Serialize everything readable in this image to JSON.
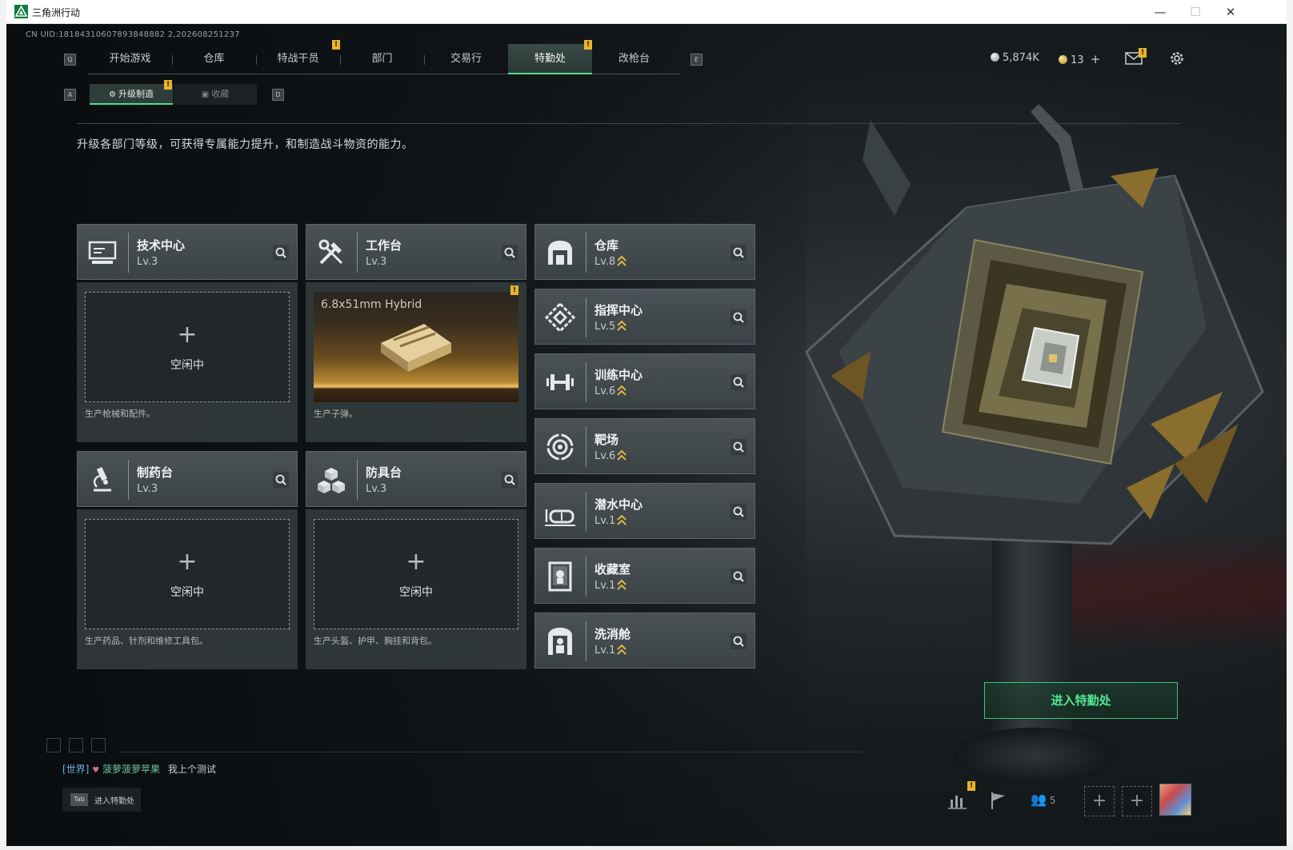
{
  "window": {
    "title": "三角洲行动",
    "buttons": {
      "minimize": "—",
      "maximize": "☐",
      "close": "✕"
    }
  },
  "uid": "CN UID:18184310607893848882 2,202608251237",
  "nav": {
    "left_key": "Q",
    "right_key": "E",
    "tabs": [
      "开始游戏",
      "仓库",
      "特战干员",
      "部门",
      "交易行",
      "特勤处",
      "改枪台"
    ],
    "active_tab": "特勤处"
  },
  "subnav": {
    "left_key": "A",
    "right_key": "D",
    "tabs": [
      "升级制造",
      "收藏"
    ],
    "active_tab": "升级制造"
  },
  "currency": {
    "main": "5,874K",
    "secondary": "13",
    "plus": "+"
  },
  "alert_glyph": "!",
  "description": "升级各部门等级，可获得专属能力提升，和制造战斗物资的能力。",
  "production_cards": [
    {
      "name": "技术中心",
      "level": "Lv.3",
      "icon": "monitor-icon",
      "state": "idle",
      "plus": "+",
      "idle_label": "空闲中",
      "caption": "生产枪械和配件。"
    },
    {
      "name": "工作台",
      "level": "Lv.3",
      "icon": "wrench-hammer-icon",
      "state": "producing",
      "product": "6.8x51mm Hybrid",
      "caption": "生产子弹。"
    },
    {
      "name": "制药台",
      "level": "Lv.3",
      "icon": "microscope-icon",
      "state": "idle",
      "plus": "+",
      "idle_label": "空闲中",
      "caption": "生产药品、针剂和维修工具包。"
    },
    {
      "name": "防具台",
      "level": "Lv.3",
      "icon": "armor-blocks-icon",
      "state": "idle",
      "plus": "+",
      "idle_label": "空闲中",
      "caption": "生产头盔、护甲、胸挂和背包。"
    }
  ],
  "facilities": [
    {
      "name": "仓库",
      "level": "Lv.8",
      "icon": "warehouse-icon"
    },
    {
      "name": "指挥中心",
      "level": "Lv.5",
      "icon": "command-diamond-icon"
    },
    {
      "name": "训练中心",
      "level": "Lv.6",
      "icon": "dumbbell-icon"
    },
    {
      "name": "靶场",
      "level": "Lv.6",
      "icon": "target-icon"
    },
    {
      "name": "潜水中心",
      "level": "Lv.1",
      "icon": "diving-mask-icon"
    },
    {
      "name": "收藏室",
      "level": "Lv.1",
      "icon": "collection-case-icon"
    },
    {
      "name": "洗消舱",
      "level": "Lv.1",
      "icon": "decon-chamber-icon"
    }
  ],
  "enter_button": "进入特勤处",
  "chat": {
    "channel": "[世界]",
    "user": "菠萝菠萝苹果",
    "message": "我上个测试"
  },
  "tab_hint": {
    "key": "Tab",
    "label": "进入特勤处"
  },
  "friends_count": "5",
  "colors": {
    "accent_green": "#4ee08a",
    "alert_yellow": "#e8b428",
    "upgrade_gold": "#e2b640"
  }
}
